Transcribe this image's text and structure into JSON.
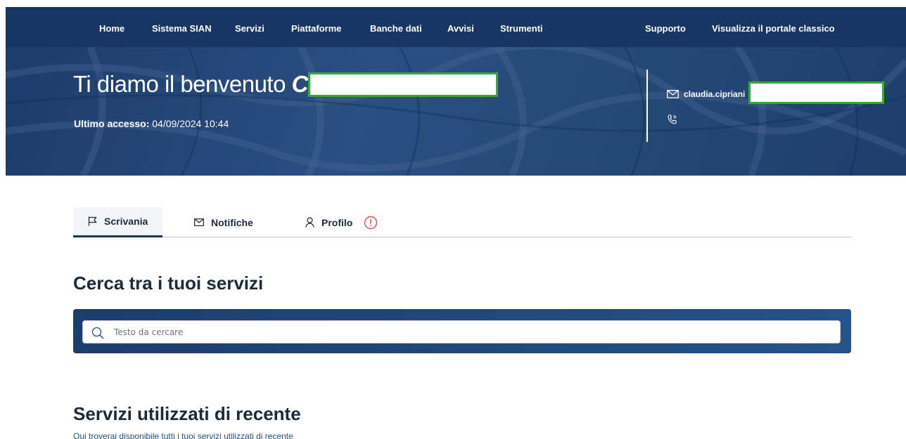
{
  "nav": {
    "items": [
      "Home",
      "Sistema SIAN",
      "Servizi",
      "Piattaforme",
      "Banche dati",
      "Avvisi",
      "Strumenti"
    ],
    "right_items": [
      "Supporto",
      "Visualizza il portale classico"
    ]
  },
  "hero": {
    "greeting": "Ti diamo il benvenuto ",
    "name_visible": "CLA",
    "last_access_label": "Ultimo accesso:",
    "last_access_value": " 04/09/2024 10:44",
    "email_visible": "claudia.cipriani",
    "mail_icon": "mail-icon",
    "phone_icon": "phone-icon"
  },
  "tabs": [
    {
      "label": "Scrivania",
      "icon": "flag-icon",
      "active": true
    },
    {
      "label": "Notifiche",
      "icon": "mail-icon",
      "active": false
    },
    {
      "label": "Profilo",
      "icon": "user-icon",
      "active": false,
      "alert_icon": "alert-icon"
    }
  ],
  "search": {
    "heading": "Cerca tra i tuoi servizi",
    "placeholder": "Testo da cercare"
  },
  "recent": {
    "heading": "Servizi utilizzati di recente",
    "subtitle": "Qui troverai disponibile tutti i tuoi servizi utilizzati di recente"
  },
  "colors": {
    "nav_bg": "#173664",
    "alert": "#d9534f",
    "redaction_border": "#3aa63a"
  }
}
